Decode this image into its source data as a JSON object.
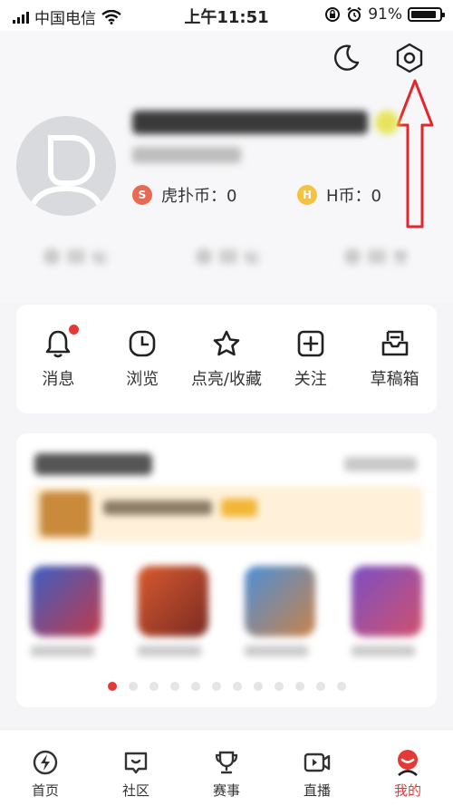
{
  "status_bar": {
    "carrier": "中国电信",
    "time": "上午11:51",
    "battery": "91%",
    "battery_level": 0.91
  },
  "header": {
    "theme_icon": "moon-icon",
    "settings_icon": "settings-hexagon-icon",
    "coins": [
      {
        "label": "虎扑币：0",
        "icon_letter": "S",
        "color": "#e96a52"
      },
      {
        "label": "H币：0",
        "icon_letter": "H",
        "color": "#f5c242"
      }
    ],
    "stats": [
      "帖",
      "帖",
      "赞"
    ]
  },
  "quick_actions": [
    {
      "label": "消息",
      "icon": "bell-icon",
      "has_dot": true
    },
    {
      "label": "浏览",
      "icon": "clock-icon",
      "has_dot": false
    },
    {
      "label": "点亮/收藏",
      "icon": "star-icon",
      "has_dot": false
    },
    {
      "label": "关注",
      "icon": "plus-square-icon",
      "has_dot": false
    },
    {
      "label": "草稿箱",
      "icon": "inbox-icon",
      "has_dot": false
    }
  ],
  "promo": {
    "dots_count": 12,
    "active_dot": 0
  },
  "tabs": [
    {
      "label": "首页",
      "icon": "lightning-home-icon",
      "active": false
    },
    {
      "label": "社区",
      "icon": "community-chat-icon",
      "active": false
    },
    {
      "label": "赛事",
      "icon": "trophy-icon",
      "active": false
    },
    {
      "label": "直播",
      "icon": "video-play-icon",
      "active": false
    },
    {
      "label": "我的",
      "icon": "profile-icon",
      "active": true
    }
  ],
  "colors": {
    "accent": "#e53935",
    "arrow": "#e3262b"
  }
}
